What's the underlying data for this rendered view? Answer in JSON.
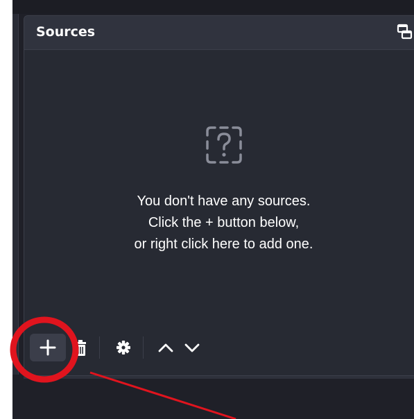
{
  "dock": {
    "title": "Sources"
  },
  "empty_state": {
    "icon": "dashed-question-icon",
    "lines": [
      "You don't have any sources.",
      "Click the + button below,",
      "or right click here to add one."
    ]
  },
  "toolbar": {
    "buttons": [
      {
        "name": "add-source-button",
        "icon": "plus-icon"
      },
      {
        "name": "remove-source-button",
        "icon": "trash-icon"
      },
      {
        "name": "source-properties-button",
        "icon": "gear-icon"
      },
      {
        "name": "move-source-up-button",
        "icon": "chevron-up-icon"
      },
      {
        "name": "move-source-down-button",
        "icon": "chevron-down-icon"
      }
    ]
  },
  "annotation": {
    "highlight_color": "#e0141e"
  },
  "colors": {
    "panel": "#272a33",
    "header": "#30333e",
    "accent_button": "#3b3e4a",
    "text": "#ffffff"
  }
}
